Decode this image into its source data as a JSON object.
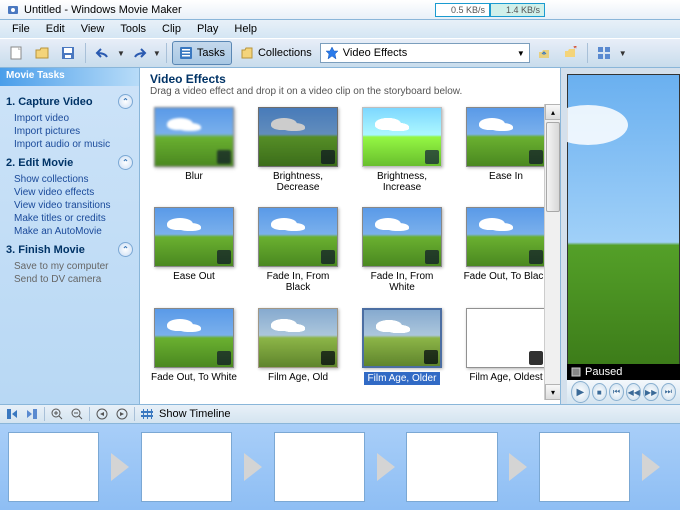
{
  "title": "Untitled - Windows Movie Maker",
  "speeds": {
    "down": "0.5 KB/s",
    "up": "1.4 KB/s"
  },
  "menu": [
    "File",
    "Edit",
    "View",
    "Tools",
    "Clip",
    "Play",
    "Help"
  ],
  "toolbar": {
    "tasks": "Tasks",
    "collections": "Collections",
    "combo_value": "Video Effects"
  },
  "tasks_panel": {
    "header": "Movie Tasks",
    "sections": [
      {
        "title": "1. Capture Video",
        "items": [
          "Import video",
          "Import pictures",
          "Import audio or music"
        ],
        "gray": false
      },
      {
        "title": "2. Edit Movie",
        "items": [
          "Show collections",
          "View video effects",
          "View video transitions",
          "Make titles or credits",
          "Make an AutoMovie"
        ],
        "gray": false
      },
      {
        "title": "3. Finish Movie",
        "items": [
          "Save to my computer",
          "Send to DV camera"
        ],
        "gray": true
      }
    ]
  },
  "content": {
    "title": "Video Effects",
    "subtitle": "Drag a video effect and drop it on a video clip on the storyboard below.",
    "effects": [
      "Blur",
      "Brightness, Decrease",
      "Brightness, Increase",
      "Ease In",
      "Ease Out",
      "Fade In, From Black",
      "Fade In, From White",
      "Fade Out, To Black",
      "Fade Out, To White",
      "Film Age, Old",
      "Film Age, Older",
      "Film Age, Oldest"
    ],
    "selected_index": 10
  },
  "preview": {
    "status": "Paused"
  },
  "timeline": {
    "button": "Show Timeline"
  }
}
